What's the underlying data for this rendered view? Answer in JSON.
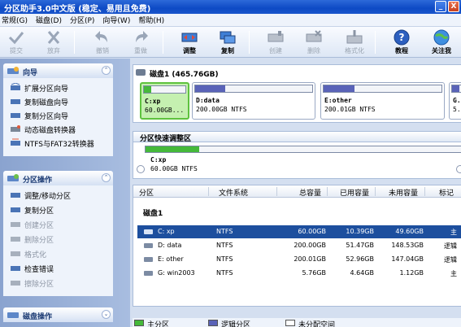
{
  "window": {
    "title": "分区助手3.0中文版 (稳定、易用且免费)",
    "minimize": "_",
    "close": "X"
  },
  "menu": [
    "常规(G)",
    "磁盘(D)",
    "分区(P)",
    "向导(W)",
    "帮助(H)"
  ],
  "toolbar": [
    {
      "label": "提交",
      "icon": "check-icon",
      "enabled": false
    },
    {
      "label": "放弃",
      "icon": "x-icon",
      "enabled": false
    },
    {
      "label": "撤销",
      "icon": "undo-icon",
      "enabled": false
    },
    {
      "label": "重做",
      "icon": "redo-icon",
      "enabled": false
    },
    {
      "label": "调整",
      "icon": "resize-icon",
      "enabled": true
    },
    {
      "label": "复制",
      "icon": "copy-icon",
      "enabled": true
    },
    {
      "label": "创建",
      "icon": "create-icon",
      "enabled": false
    },
    {
      "label": "删除",
      "icon": "delete-icon",
      "enabled": false
    },
    {
      "label": "格式化",
      "icon": "format-icon",
      "enabled": false
    },
    {
      "label": "教程",
      "icon": "help-icon",
      "enabled": true
    },
    {
      "label": "关注我",
      "icon": "globe-icon",
      "enabled": true
    }
  ],
  "wizard_panel": {
    "title": "向导",
    "collapse": "⌃",
    "items": [
      "扩展分区向导",
      "复制磁盘向导",
      "复制分区向导",
      "动态磁盘转换器",
      "NTFS与FAT32转换器"
    ]
  },
  "ops_panel": {
    "title": "分区操作",
    "collapse": "⌃",
    "items": [
      {
        "label": "调整/移动分区",
        "enabled": true
      },
      {
        "label": "复制分区",
        "enabled": true
      },
      {
        "label": "创建分区",
        "enabled": false
      },
      {
        "label": "删除分区",
        "enabled": false
      },
      {
        "label": "格式化",
        "enabled": false
      },
      {
        "label": "检查错误",
        "enabled": true
      },
      {
        "label": "擦除分区",
        "enabled": false
      }
    ]
  },
  "disk_panel": {
    "title": "磁盘操作",
    "collapse": "⌄"
  },
  "disk_strip": {
    "title": "磁盘1 (465.76GB)",
    "partitions": [
      {
        "name": "C:xp",
        "size": "60.00GB...",
        "used_pct": 17,
        "color": "#45b93a",
        "selected": true
      },
      {
        "name": "D:data",
        "size": "200.00GB NTFS",
        "used_pct": 26,
        "color": "#5a63b8",
        "selected": false
      },
      {
        "name": "E:other",
        "size": "200.01GB NTFS",
        "used_pct": 26,
        "color": "#5a63b8",
        "selected": false
      },
      {
        "name": "G.",
        "size": "5.",
        "used_pct": 80,
        "color": "#5a63b8",
        "selected": false
      }
    ]
  },
  "quick_resize": {
    "title": "分区快速调整区",
    "name": "C:xp",
    "size": "60.00GB NTFS",
    "used_pct": 17
  },
  "table": {
    "headers": [
      "分区",
      "文件系统",
      "总容量",
      "已用容量",
      "未用容量",
      "标记"
    ],
    "group": "磁盘1",
    "rows": [
      {
        "part": "C:  xp",
        "fs": "NTFS",
        "total": "60.00GB",
        "used": "10.39GB",
        "free": "49.60GB",
        "flag": "主",
        "selected": true
      },
      {
        "part": "D:  data",
        "fs": "NTFS",
        "total": "200.00GB",
        "used": "51.47GB",
        "free": "148.53GB",
        "flag": "逻辑",
        "selected": false
      },
      {
        "part": "E:  other",
        "fs": "NTFS",
        "total": "200.01GB",
        "used": "52.96GB",
        "free": "147.04GB",
        "flag": "逻辑",
        "selected": false
      },
      {
        "part": "G:  win2003",
        "fs": "NTFS",
        "total": "5.76GB",
        "used": "4.64GB",
        "free": "1.12GB",
        "flag": "主",
        "selected": false
      }
    ]
  },
  "legend": [
    {
      "label": "主分区",
      "color": "#45b93a"
    },
    {
      "label": "逻辑分区",
      "color": "#5a63b8"
    },
    {
      "label": "未分配空间",
      "color": "#ffffff"
    }
  ]
}
